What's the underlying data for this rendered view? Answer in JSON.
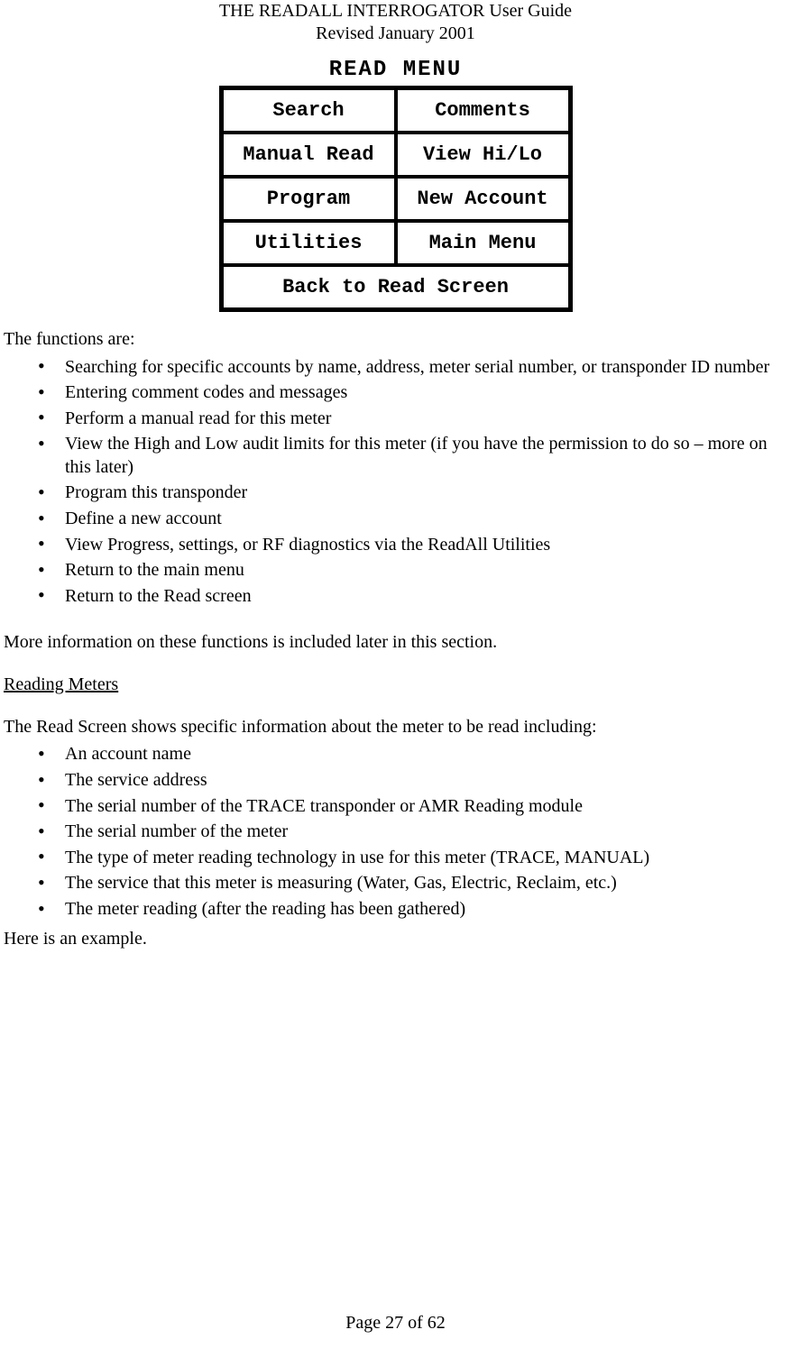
{
  "header": {
    "title": "THE READALL INTERROGATOR User Guide",
    "revised": "Revised January 2001"
  },
  "read_menu": {
    "title": "READ MENU",
    "buttons": {
      "search": "Search",
      "comments": "Comments",
      "manual_read": "Manual Read",
      "view_hilo": "View Hi/Lo",
      "program": "Program",
      "new_account": "New Account",
      "utilities": "Utilities",
      "main_menu": "Main Menu",
      "back": "Back to Read Screen"
    }
  },
  "body": {
    "functions_intro": "The functions are:",
    "functions": [
      "Searching for specific accounts by name, address, meter serial number, or transponder ID number",
      "Entering comment codes and messages",
      "Perform a manual read for this meter",
      "View the High and Low audit limits for this meter (if you have the permission to do so – more on this later)",
      "Program this transponder",
      "Define a new account",
      "View Progress, settings, or RF diagnostics via the ReadAll Utilities",
      "Return to the main menu",
      "Return to the Read screen"
    ],
    "more_info": "More information on these functions is included later in this section.",
    "section_heading": "Reading Meters",
    "readscreen_intro": "The Read Screen shows specific information about the meter to be read including:",
    "readscreen_items": [
      "An account name",
      "The service address",
      "The serial number of the TRACE transponder or AMR Reading module",
      "The serial number of the meter",
      "The type of meter reading technology in use for this meter (TRACE, MANUAL)",
      "The service that this meter is measuring (Water, Gas, Electric, Reclaim, etc.)",
      "The meter reading (after the reading has been gathered)"
    ],
    "example_intro": "Here is an example."
  },
  "footer": {
    "page": "Page 27 of 62"
  }
}
